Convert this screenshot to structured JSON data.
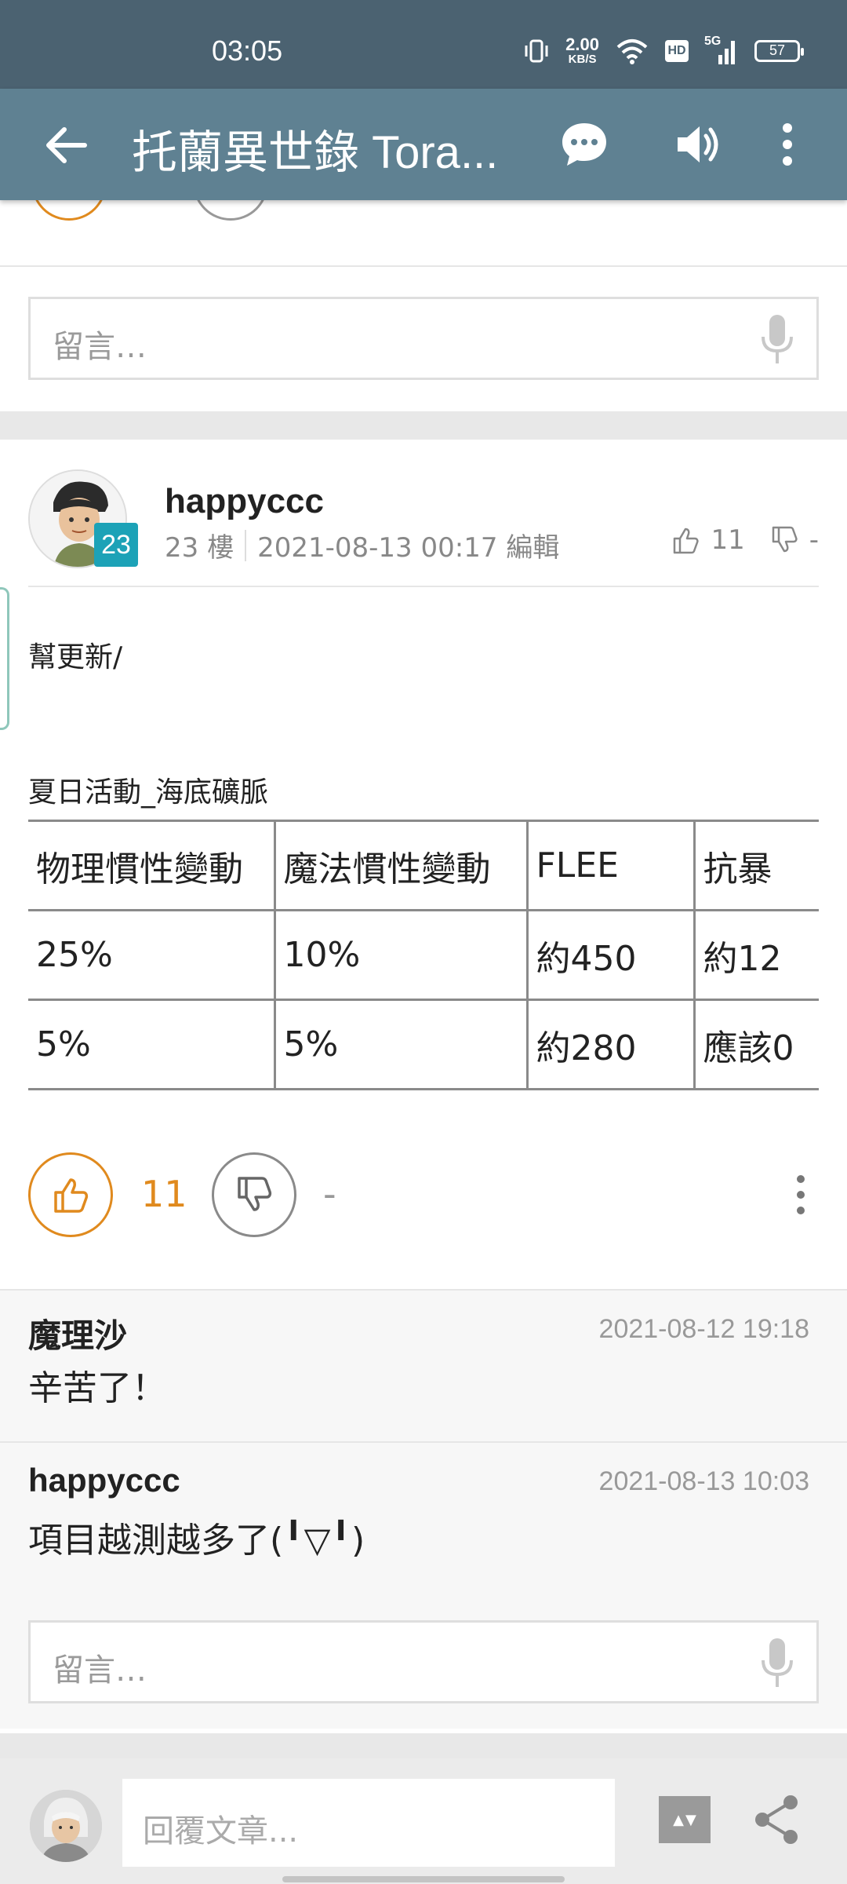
{
  "status_bar": {
    "time": "03:05",
    "net_speed_value": "2.00",
    "net_speed_unit": "KB/S",
    "network": "5G",
    "hd_label": "HD",
    "battery": "57"
  },
  "app_bar": {
    "title": "托蘭異世錄 Tora...",
    "icons": [
      "back-arrow-icon",
      "chat-bubble-icon",
      "speaker-icon",
      "more-vert-icon"
    ]
  },
  "top_comment_box": {
    "placeholder": "留言…"
  },
  "post": {
    "username": "happyccc",
    "floor_badge": "23",
    "floor": "23 樓",
    "timestamp": "2021-08-13 00:17 編輯",
    "likes": "11",
    "dislikes": "-",
    "text_line_1": "幫更新/",
    "text_line_2": "夏日活動_海底礦脈",
    "table": {
      "rows": [
        [
          "物理慣性變動",
          "魔法慣性變動",
          "FLEE",
          "抗暴"
        ],
        [
          "25%",
          "10%",
          "約450",
          "約12"
        ],
        [
          "5%",
          "5%",
          "約280",
          "應該0"
        ]
      ]
    },
    "vote_like_count": "11",
    "vote_dislike_count": "-"
  },
  "replies": [
    {
      "name": "魔理沙",
      "time": "2021-08-12 19:18",
      "text": "辛苦了！"
    },
    {
      "name": "happyccc",
      "time": "2021-08-13 10:03",
      "text": "項目越測越多了(╹▽╹)"
    }
  ],
  "bottom_comment_box": {
    "placeholder": "留言…"
  },
  "bottom_bar": {
    "reply_placeholder": "回覆文章..."
  },
  "colors": {
    "status_bar": "#4b6271",
    "app_bar": "#5f8192",
    "like_accent": "#e08a1e",
    "floor_badge": "#1ca2b7"
  }
}
